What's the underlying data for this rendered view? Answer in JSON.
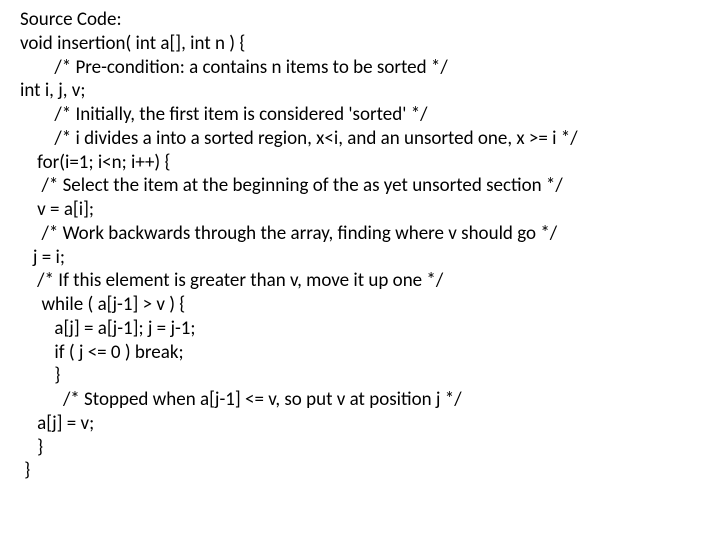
{
  "lines": [
    "Source Code:",
    "void insertion( int a[], int n ) {",
    "        /* Pre-condition: a contains n items to be sorted */",
    "int i, j, v;",
    "        /* Initially, the first item is considered 'sorted' */",
    "        /* i divides a into a sorted region, x<i, and an unsorted one, x >= i */",
    "    for(i=1; i<n; i++) {",
    "     /* Select the item at the beginning of the as yet unsorted section */",
    "    v = a[i];",
    "     /* Work backwards through the array, finding where v should go */",
    "   j = i;",
    "    /* If this element is greater than v, move it up one */",
    "     while ( a[j-1] > v ) {",
    "        a[j] = a[j-1]; j = j-1;",
    "        if ( j <= 0 ) break;",
    "        }",
    "          /* Stopped when a[j-1] <= v, so put v at position j */",
    "    a[j] = v;",
    "    }",
    " }"
  ]
}
